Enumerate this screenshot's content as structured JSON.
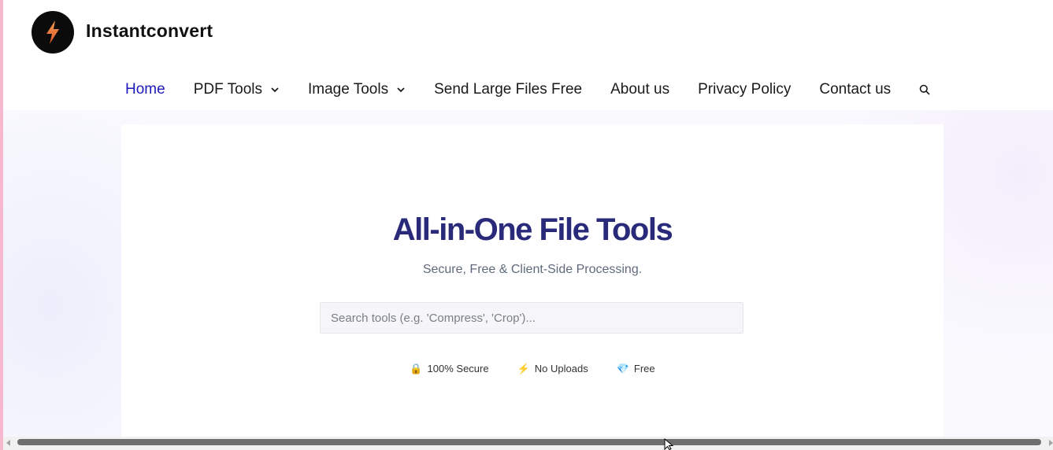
{
  "site": {
    "brand": "Instantconvert",
    "logo_icon": "lightning-bolt-icon",
    "accent_color": "#1c1ab8"
  },
  "nav": {
    "items": [
      {
        "label": "Home",
        "active": true,
        "has_dropdown": false
      },
      {
        "label": "PDF Tools",
        "active": false,
        "has_dropdown": true
      },
      {
        "label": "Image Tools",
        "active": false,
        "has_dropdown": true
      },
      {
        "label": "Send Large Files Free",
        "active": false,
        "has_dropdown": false
      },
      {
        "label": "About us",
        "active": false,
        "has_dropdown": false
      },
      {
        "label": "Privacy Policy",
        "active": false,
        "has_dropdown": false
      },
      {
        "label": "Contact us",
        "active": false,
        "has_dropdown": false
      }
    ],
    "search_icon": "search-icon"
  },
  "hero": {
    "title": "All-in-One File Tools",
    "subtitle": "Secure, Free & Client-Side Processing.",
    "search_placeholder": "Search tools (e.g. 'Compress', 'Crop')...",
    "search_value": "",
    "badges": [
      {
        "icon": "🔒",
        "icon_name": "lock-icon",
        "label": "100% Secure"
      },
      {
        "icon": "⚡",
        "icon_name": "lightning-icon",
        "label": "No Uploads"
      },
      {
        "icon": "💎",
        "icon_name": "gem-icon",
        "label": "Free"
      }
    ]
  },
  "colors": {
    "title": "#2a2a7a",
    "subtitle": "#5f6b7c"
  }
}
